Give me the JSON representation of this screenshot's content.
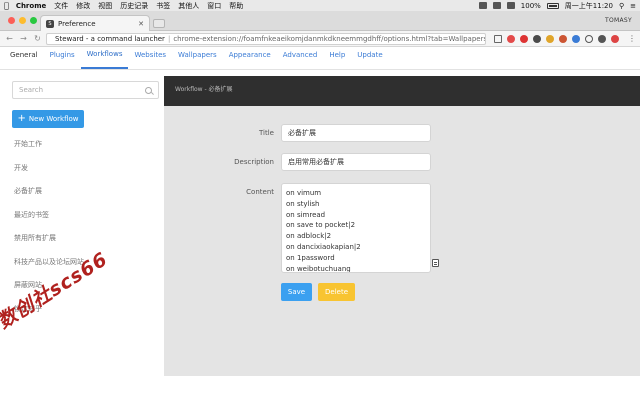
{
  "menubar": {
    "app": "Chrome",
    "items": [
      "文件",
      "修改",
      "视图",
      "历史记录",
      "书签",
      "其他人",
      "窗口",
      "帮助"
    ],
    "battery": "100%",
    "datetime": "周一上午11:20"
  },
  "browser": {
    "tab_title": "Preference",
    "favicon_letter": "S",
    "profile": "TOMASY",
    "url_origin": "Steward - a command launcher",
    "url_path": "chrome-extension://foamfnkeaeikomjdanmkdkneemmgdhff/options.html?tab=Wallpapers"
  },
  "appnav": {
    "tabs": [
      "General",
      "Plugins",
      "Workflows",
      "Websites",
      "Wallpapers",
      "Appearance",
      "Advanced",
      "Help",
      "Update"
    ],
    "active_index": 2
  },
  "sidebar": {
    "search_placeholder": "Search",
    "new_workflow_label": "New Workflow",
    "workflows": [
      "开始工作",
      "开发",
      "必备扩展",
      "最近的书签",
      "禁用所有扩展",
      "科技产品以及论坛网站",
      "屏蔽网站",
      "锁定知乎"
    ]
  },
  "main": {
    "header": "Workflow - 必备扩展",
    "title_label": "Title",
    "title_value": "必备扩展",
    "description_label": "Description",
    "description_value": "启用常用必备扩展",
    "content_label": "Content",
    "content_lines": [
      "on vimum",
      "on stylish",
      "on simread",
      "on save to pocket|2",
      "on adblock|2",
      "on dancixiaokapian|2",
      "on 1password",
      "on weibotuchuang"
    ],
    "save_label": "Save",
    "delete_label": "Delete"
  },
  "watermark": "数创社scs66",
  "colors": {
    "accent": "#3a7bd5",
    "save_button": "#3ba0f0",
    "delete_button": "#f8c431",
    "header_bg": "#2f2f2f",
    "panel_bg": "#e4e4e4"
  }
}
